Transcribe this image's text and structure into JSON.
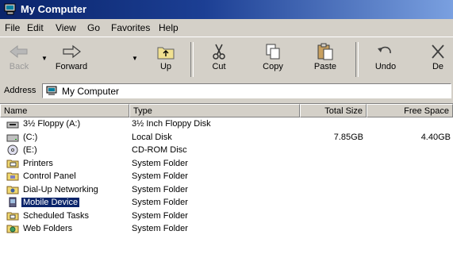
{
  "window": {
    "title": "My Computer"
  },
  "menu": {
    "items": [
      {
        "id": "file",
        "label": "File"
      },
      {
        "id": "edit",
        "label": "Edit"
      },
      {
        "id": "view",
        "label": "View"
      },
      {
        "id": "go",
        "label": "Go"
      },
      {
        "id": "favorites",
        "label": "Favorites"
      },
      {
        "id": "help",
        "label": "Help"
      }
    ]
  },
  "toolbar": {
    "back_label": "Back",
    "forward_label": "Forward",
    "up_label": "Up",
    "cut_label": "Cut",
    "copy_label": "Copy",
    "paste_label": "Paste",
    "undo_label": "Undo",
    "delete_label": "De"
  },
  "address": {
    "label": "Address",
    "value": "My Computer"
  },
  "columns": {
    "name": "Name",
    "type": "Type",
    "total_size": "Total Size",
    "free_space": "Free Space"
  },
  "rows": [
    {
      "name": "3½ Floppy (A:)",
      "type": "3½ Inch Floppy Disk",
      "total": "",
      "free": "",
      "icon": "floppy-drive-icon"
    },
    {
      "name": "(C:)",
      "type": "Local Disk",
      "total": "7.85GB",
      "free": "4.40GB",
      "icon": "hard-disk-icon"
    },
    {
      "name": "(E:)",
      "type": "CD-ROM Disc",
      "total": "",
      "free": "",
      "icon": "cd-rom-icon"
    },
    {
      "name": "Printers",
      "type": "System Folder",
      "total": "",
      "free": "",
      "icon": "printers-folder-icon"
    },
    {
      "name": "Control Panel",
      "type": "System Folder",
      "total": "",
      "free": "",
      "icon": "control-panel-folder-icon"
    },
    {
      "name": "Dial-Up Networking",
      "type": "System Folder",
      "total": "",
      "free": "",
      "icon": "dial-up-networking-icon"
    },
    {
      "name": "Mobile Device",
      "type": "System Folder",
      "total": "",
      "free": "",
      "icon": "mobile-device-icon",
      "selected": true
    },
    {
      "name": "Scheduled Tasks",
      "type": "System Folder",
      "total": "",
      "free": "",
      "icon": "scheduled-tasks-folder-icon"
    },
    {
      "name": "Web Folders",
      "type": "System Folder",
      "total": "",
      "free": "",
      "icon": "web-folders-icon"
    }
  ],
  "colors": {
    "title_start": "#0a246a",
    "title_end": "#7aa0e0",
    "selection": "#0a246a",
    "chrome": "#d4d0c8"
  }
}
